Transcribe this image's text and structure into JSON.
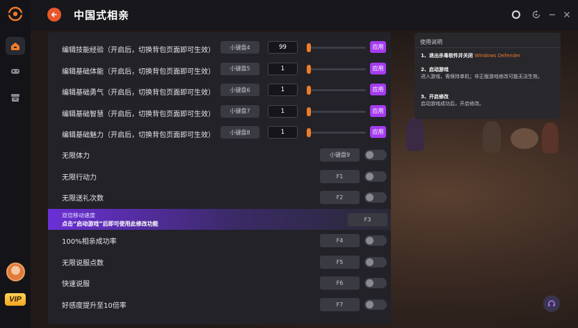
{
  "app": {
    "title": "中国式相亲"
  },
  "sidebar": {
    "items": [
      {
        "name": "home",
        "icon": "home-icon",
        "active": true
      },
      {
        "name": "games",
        "icon": "gamepad-icon",
        "active": false
      },
      {
        "name": "library",
        "icon": "box-icon",
        "active": false
      }
    ],
    "vip_label": "VIP"
  },
  "header": {
    "icons": [
      "record-icon",
      "refresh-icon",
      "minimize-icon",
      "close-icon"
    ]
  },
  "slider_rows": [
    {
      "label": "编辑技能经验（开启后，切换背包页面即可生效）",
      "key": "小键盘4",
      "value": "99",
      "level": 0.0,
      "apply": "应用"
    },
    {
      "label": "编辑基础体能（开启后，切换背包页面即可生效）",
      "key": "小键盘5",
      "value": "1",
      "level": 0.0,
      "apply": "应用"
    },
    {
      "label": "编辑基础勇气（开启后，切换背包页面即可生效）",
      "key": "小键盘6",
      "value": "1",
      "level": 0.0,
      "apply": "应用"
    },
    {
      "label": "编辑基础智慧（开启后，切换背包页面即可生效）",
      "key": "小键盘7",
      "value": "1",
      "level": 0.0,
      "apply": "应用"
    },
    {
      "label": "编辑基础魅力（开启后，切换背包页面即可生效）",
      "key": "小键盘8",
      "value": "1",
      "level": 0.0,
      "apply": "应用"
    }
  ],
  "toggle_rows_a": [
    {
      "label": "无限体力",
      "key": "小键盘9",
      "on": false
    },
    {
      "label": "无限行动力",
      "key": "F1",
      "on": false
    },
    {
      "label": "无限送礼次数",
      "key": "F2",
      "on": false
    }
  ],
  "promo": {
    "line1": "双倍移动速度",
    "line2": "点击“启动游戏”后即可使用此修改功能",
    "key": "F3"
  },
  "toggle_rows_b": [
    {
      "label": "100%相亲成功率",
      "key": "F4",
      "on": false
    },
    {
      "label": "无限说服点数",
      "key": "F5",
      "on": false
    },
    {
      "label": "快速说服",
      "key": "F6",
      "on": false
    },
    {
      "label": "好感度提升至10倍率",
      "key": "F7",
      "on": false
    }
  ],
  "help": {
    "title": "使用说明",
    "step1_title": "1、退出杀毒软件并关闭",
    "step1_accent": "Windows Defender",
    "step2_title": "2、启动游戏",
    "step2_body": "进入游戏，需保持单机；非正版游戏修改可能无法生效。",
    "step3_title": "3、开启修改",
    "step3_body": "启动游戏成功后，开启修改。"
  },
  "colors": {
    "accent": "#f07b2a",
    "apply": "#a53cf0",
    "panel": "#222228",
    "background": "#17171c"
  }
}
